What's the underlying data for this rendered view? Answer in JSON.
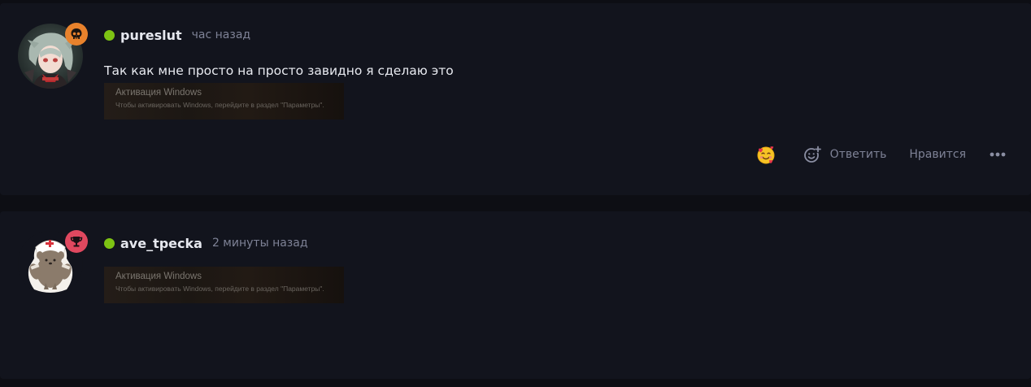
{
  "colors": {
    "background": "#0d0e14",
    "card": "#12141d",
    "online": "#7dc313",
    "username": "#e6e8ef",
    "muted": "#7e8296",
    "badge_skull": "#e8822c",
    "badge_trophy": "#e0485f"
  },
  "posts": [
    {
      "author": "pureslut",
      "time": "час назад",
      "badge_icon": "skull-icon",
      "text": "Так как мне просто на просто завидно я сделаю это",
      "embed": {
        "title": "Активация Windows",
        "subtitle": "Чтобы активировать Windows, перейдите в раздел \"Параметры\"."
      },
      "actions": {
        "reaction_icon": "smiling-face-with-hearts-icon",
        "add_reaction_icon": "add-reaction-icon",
        "reply": "Ответить",
        "like": "Нравится",
        "more_icon": "more-icon"
      }
    },
    {
      "author": "ave_tpecka",
      "time": "2 минуты назад",
      "badge_icon": "trophy-icon",
      "embed": {
        "title": "Активация Windows",
        "subtitle": "Чтобы активировать Windows, перейдите в раздел \"Параметры\"."
      }
    }
  ]
}
